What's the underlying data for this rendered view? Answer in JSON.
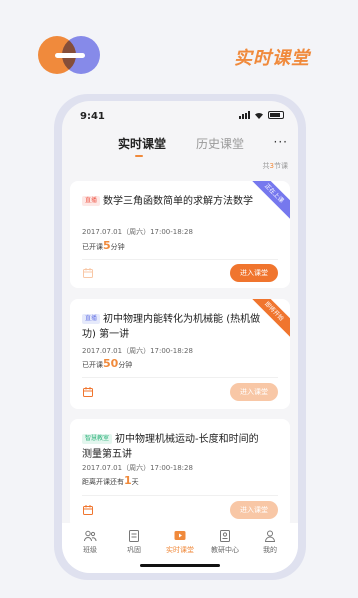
{
  "promo": {
    "title": "实时课堂"
  },
  "status_bar": {
    "time": "9:41"
  },
  "tabs": [
    {
      "label": "实时课堂",
      "active": true
    },
    {
      "label": "历史课堂",
      "active": false
    }
  ],
  "more_label": "···",
  "total": {
    "prefix": "共",
    "count": "3",
    "suffix": "节课"
  },
  "courses": [
    {
      "tag": "直播",
      "title": "数学三角函数简单的求解方法数学",
      "ribbon": "正在上课",
      "date": "2017.07.01（周六）17:00-18:28",
      "status_prefix": "已开课",
      "status_value": "5",
      "status_suffix": "分钟",
      "button": "进入课堂",
      "button_enabled": true
    },
    {
      "tag": "直播",
      "title": "初中物理内能转化为机械能 (热机做功) 第一讲",
      "ribbon": "即将开始",
      "date": "2017.07.01（周六）17:00-18:28",
      "status_prefix": "已开课",
      "status_value": "50",
      "status_suffix": "分钟",
      "button": "进入课堂",
      "button_enabled": false
    },
    {
      "tag": "智慧教室",
      "title": "初中物理机械运动-长度和时间的测量第五讲",
      "ribbon": "",
      "date": "2017.07.01（周六）17:00-18:28",
      "status_prefix": "距离开课还有",
      "status_value": "1",
      "status_suffix": "天",
      "button": "进入课堂",
      "button_enabled": false
    }
  ],
  "nav": [
    {
      "label": "班级",
      "icon": "class-icon"
    },
    {
      "label": "巩固",
      "icon": "review-icon"
    },
    {
      "label": "实时课堂",
      "icon": "live-class-icon",
      "active": true
    },
    {
      "label": "教研中心",
      "icon": "research-icon"
    },
    {
      "label": "我的",
      "icon": "profile-icon"
    }
  ],
  "colors": {
    "accent": "#f08a3c",
    "brand_purple": "#8d90f0",
    "button": "#f0752e"
  }
}
